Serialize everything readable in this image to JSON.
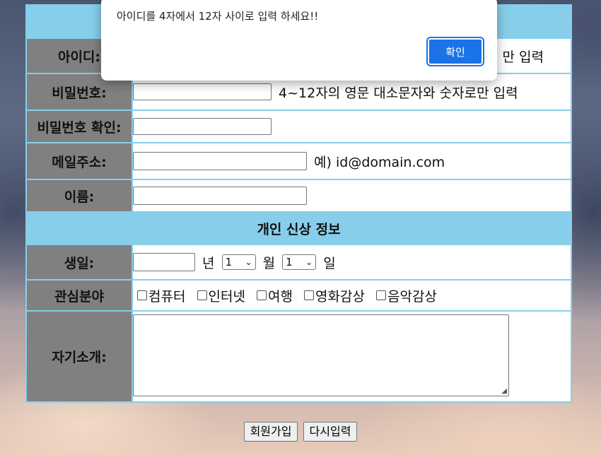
{
  "form": {
    "labels": {
      "id": "아이디:",
      "password": "비밀번호:",
      "password_confirm": "비밀번호 확인:",
      "email": "메일주소:",
      "name": "이름:",
      "birthday": "생일:",
      "interests": "관심분야",
      "intro": "자기소개:"
    },
    "hints": {
      "id": "만 입력",
      "password": "4~12자의 영문 대소문자와 숫자로만 입력",
      "email": "예) id@domain.com"
    },
    "section_title": "개인 신상 정보",
    "birthday": {
      "year_label": "년",
      "month_value": "1",
      "month_label": "월",
      "day_value": "1",
      "day_label": "일"
    },
    "interests": [
      "컴퓨터",
      "인터넷",
      "여행",
      "영화감상",
      "음악감상"
    ],
    "buttons": {
      "submit": "회원가입",
      "reset": "다시입력"
    }
  },
  "alert": {
    "message": "아이디를 4자에서 12자 사이로 입력 하세요!!",
    "ok_label": "확인"
  },
  "colors": {
    "header_blue": "#87ceeb",
    "label_gray": "#808080",
    "ok_button": "#1a73e8"
  }
}
